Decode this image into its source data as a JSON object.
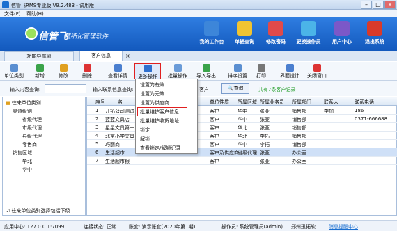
{
  "window": {
    "title": "信管飞RMS专业版 V9.2.483 - 试用版"
  },
  "menu": [
    "文件(F)",
    "帮助(H)"
  ],
  "banner": {
    "brand": "信管飞",
    "slogan": "精细化管理软件",
    "nav": [
      {
        "label": "我的工作台",
        "color": "#3d86d9"
      },
      {
        "label": "单据查询",
        "color": "#f1c431"
      },
      {
        "label": "修改密码",
        "color": "#e04a4a"
      },
      {
        "label": "更换操作员",
        "color": "#4bb4e8"
      },
      {
        "label": "用户中心",
        "color": "#7c58c8"
      },
      {
        "label": "退出系统",
        "color": "#d93a2a"
      }
    ]
  },
  "tabs": [
    "功能导航窗",
    "客户信息"
  ],
  "toolbar": [
    "单位类别",
    "新增",
    "修改",
    "删除",
    "查看详情",
    "更多操作",
    "批量操作",
    "导入导出",
    "排序设置",
    "打印",
    "界面设计",
    "关闭窗口"
  ],
  "search": {
    "label1": "输入内容查询:",
    "label2": "输入联系信息查询:",
    "field_fragment": "客户",
    "query": "查询",
    "result": "共有7条客户记录"
  },
  "tree": {
    "root": "往来单位类别",
    "items": [
      "渠道级别",
      "省级代理",
      "市级代理",
      "县级代理",
      "零售商",
      "销售区域",
      "华北",
      "华中"
    ],
    "footer": "往来单位类别选择包括下级"
  },
  "grid": {
    "headers": [
      "序号",
      "名",
      "类",
      "单位性质",
      "所属区域",
      "所属业务员",
      "所属部门",
      "联系人",
      "联系电话"
    ],
    "rows": [
      [
        "1",
        "开拓公司测试",
        "",
        "客户",
        "华中",
        "张亚",
        "销售部",
        "李加",
        "186"
      ],
      [
        "2",
        "蓝蓝文具店",
        "",
        "客户",
        "华中",
        "张亚",
        "销售部",
        "",
        "0371-666688"
      ],
      [
        "3",
        "星星文具第一",
        "",
        "客户",
        "华北",
        "张亚",
        "销售部",
        "",
        ""
      ],
      [
        "4",
        "北京小学文具",
        "",
        "客户",
        "华北",
        "李拓",
        "销售部",
        "",
        ""
      ],
      [
        "5",
        "巧丽商",
        "",
        "客户",
        "华中",
        "李拓",
        "销售部",
        "",
        ""
      ],
      [
        "6",
        "生活超市",
        "",
        "客户及供应商",
        "省级代理",
        "张亚",
        "办公室",
        "",
        ""
      ],
      [
        "7",
        "生活超市银",
        "",
        "客户",
        "",
        "张亚",
        "办公室",
        "",
        ""
      ]
    ]
  },
  "dropdown": [
    "设置为有效",
    "设置为无效",
    "设置为供应商",
    "批量维护客户信息",
    "批量维护收货地址",
    "锁定",
    "解锁",
    "查看锁定/解锁记录"
  ],
  "status": {
    "app": "应用中心: 127.0.0.1:7099",
    "conn": "连接状态: 正常",
    "account": "账套: 演示账套(2020年第1期)",
    "operator": "操作员: 系统管理员(admin)",
    "region": "郑州迅拓软",
    "msg": "消息提醒中心"
  }
}
